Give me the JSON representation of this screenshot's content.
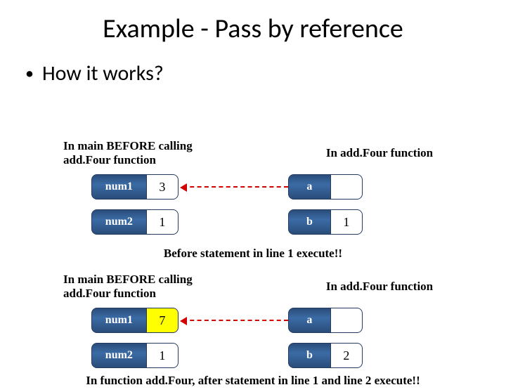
{
  "title": "Example - Pass by reference",
  "bullet": "How it works?",
  "captions": {
    "left1": "In main BEFORE calling add.Four function",
    "right1": "In add.Four function",
    "mid": "Before statement in line 1 execute!!",
    "left2": "In main BEFORE calling add.Four function",
    "right2": "In add.Four function",
    "bottom": "In function add.Four, after statement in line 1 and line 2 execute!!"
  },
  "before": {
    "main": {
      "num1": {
        "label": "num1",
        "value": "3"
      },
      "num2": {
        "label": "num2",
        "value": "1"
      }
    },
    "fn": {
      "a": {
        "label": "a",
        "value": ""
      },
      "b": {
        "label": "b",
        "value": "1"
      }
    }
  },
  "after": {
    "main": {
      "num1": {
        "label": "num1",
        "value": "7"
      },
      "num2": {
        "label": "num2",
        "value": "1"
      }
    },
    "fn": {
      "a": {
        "label": "a",
        "value": ""
      },
      "b": {
        "label": "b",
        "value": "2"
      }
    }
  }
}
